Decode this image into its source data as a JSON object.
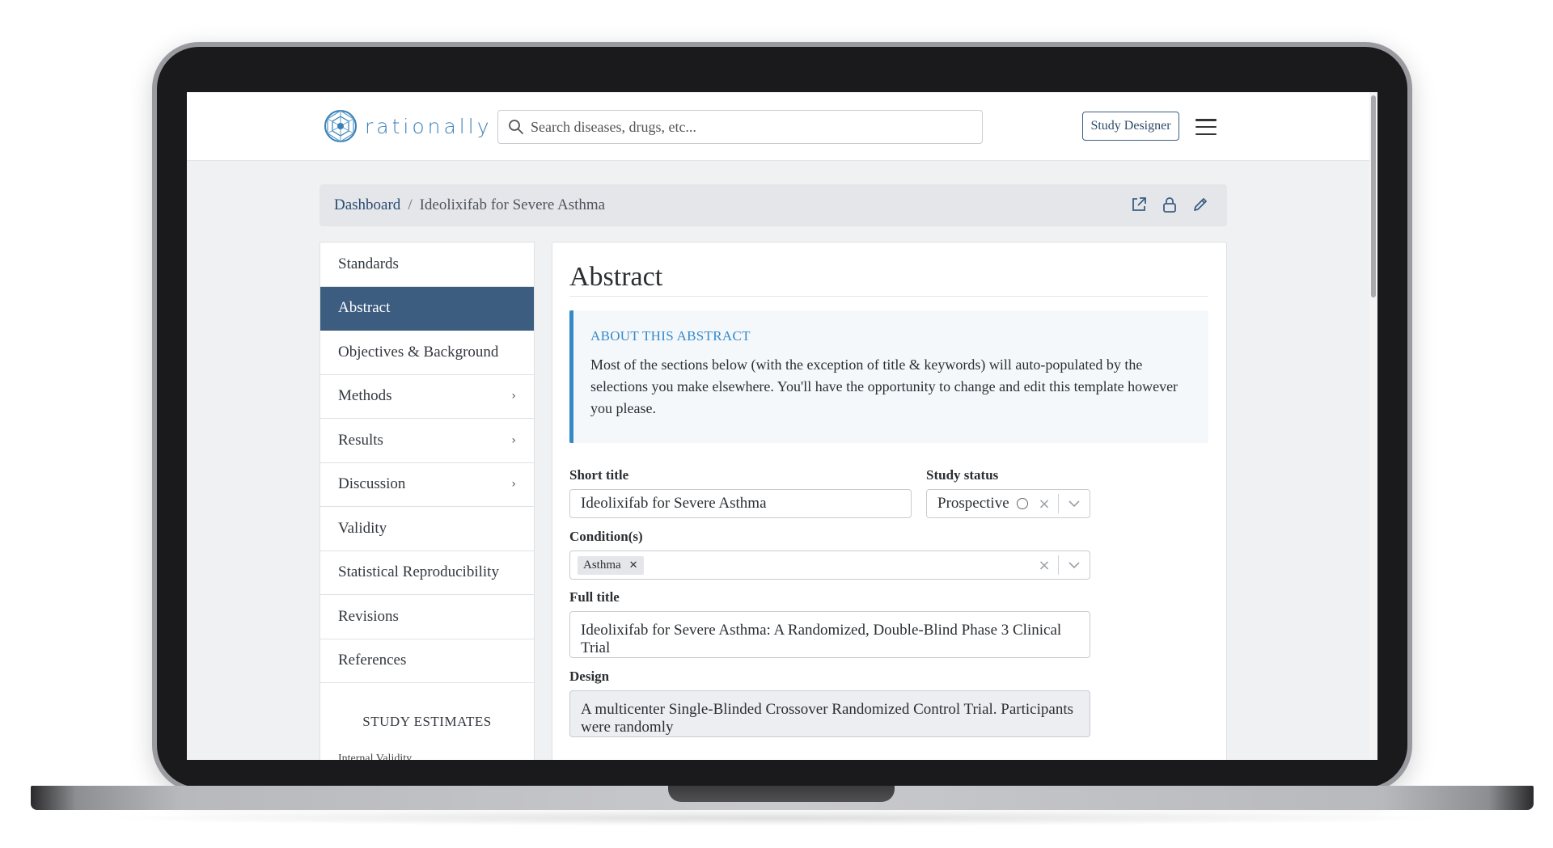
{
  "app": {
    "logo_text": "rationally",
    "search_placeholder": "Search diseases, drugs, etc...",
    "study_designer_label": "Study Designer"
  },
  "breadcrumb": {
    "root": "Dashboard",
    "separator": "/",
    "current": "Ideolixifab for Severe Asthma",
    "icons": [
      "external-link-icon",
      "lock-icon",
      "edit-icon"
    ]
  },
  "sidebar": {
    "items": [
      {
        "label": "Standards",
        "active": false,
        "has_children": false
      },
      {
        "label": "Abstract",
        "active": true,
        "has_children": false
      },
      {
        "label": "Objectives & Background",
        "active": false,
        "has_children": false
      },
      {
        "label": "Methods",
        "active": false,
        "has_children": true
      },
      {
        "label": "Results",
        "active": false,
        "has_children": true
      },
      {
        "label": "Discussion",
        "active": false,
        "has_children": true
      },
      {
        "label": "Validity",
        "active": false,
        "has_children": false
      },
      {
        "label": "Statistical Reproducibility",
        "active": false,
        "has_children": false
      },
      {
        "label": "Revisions",
        "active": false,
        "has_children": false
      },
      {
        "label": "References",
        "active": false,
        "has_children": false
      }
    ],
    "estimates_heading": "STUDY ESTIMATES",
    "internal_validity_label": "Internal Validity"
  },
  "main": {
    "heading": "Abstract",
    "info": {
      "title": "ABOUT THIS ABSTRACT",
      "body": "Most of the sections below (with the exception of title & keywords) will auto-populated by the selections you make elsewhere. You'll have the opportunity to change and edit this template however you please."
    },
    "short_title": {
      "label": "Short title",
      "value": "Ideolixifab for Severe Asthma"
    },
    "study_status": {
      "label": "Study status",
      "value": "Prospective"
    },
    "conditions": {
      "label": "Condition(s)",
      "tags": [
        "Asthma"
      ]
    },
    "full_title": {
      "label": "Full title",
      "value": "Ideolixifab for Severe Asthma: A Randomized, Double-Blind Phase 3 Clinical Trial"
    },
    "design": {
      "label": "Design",
      "value": "A multicenter Single-Blinded Crossover Randomized Control Trial. Participants were randomly"
    }
  },
  "colors": {
    "brand": "#3a7fb5",
    "active_nav": "#3c5d80",
    "info_accent": "#3589c9"
  }
}
